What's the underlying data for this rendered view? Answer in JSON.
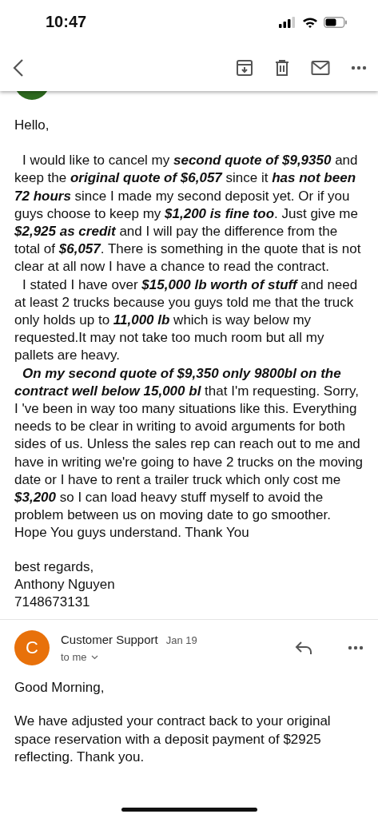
{
  "status_bar": {
    "time": "10:47"
  },
  "messages": [
    {
      "color": "#2e6b1f",
      "greeting": "Hello,",
      "paragraphs": [
        "I would like to cancel my **second quote of $9,9350** and keep the **original quote of $6,057** since it **has not been 72 hours** since I made my second deposit yet. Or if you guys choose to keep my **$1,200 is fine too**. Just give me **$2,925 as credit** and I will pay the difference from the total of **$6,057**.  There is something in the quote that is not clear at all now I have a chance to read the contract.",
        "I stated I have over **$15,000 lb worth of stuff** and need at least 2 trucks because you guys told me that the truck only holds up to **11,000 lb** which is way below my requested.It may not take too much room but all my pallets are heavy.",
        "**On my second quote of $9,350 only 9800bl on the contract well below 15,000 bl** that I'm requesting.  Sorry, I 've been in way too many situations like this. Everything needs to be clear in writing to avoid arguments for both sides of us. Unless the sales rep can reach out to me and have in writing we're going to have 2 trucks on the moving date or I have to rent a trailer truck which only cost me **$3,200** so I can load heavy stuff myself to avoid the problem between us on moving date to go smoother. Hope You guys understand. Thank You"
      ],
      "signature": [
        "best regards,",
        "Anthony Nguyen",
        "7148673131"
      ]
    },
    {
      "avatar_letter": "C",
      "color": "#e8710a",
      "sender": "Customer Support",
      "date": "Jan 19",
      "recipient": "to me",
      "greeting": "Good Morning,",
      "paragraphs": [
        "We have adjusted your contract back to your original space reservation with a deposit payment of $2925 reflecting. Thank you."
      ]
    }
  ]
}
